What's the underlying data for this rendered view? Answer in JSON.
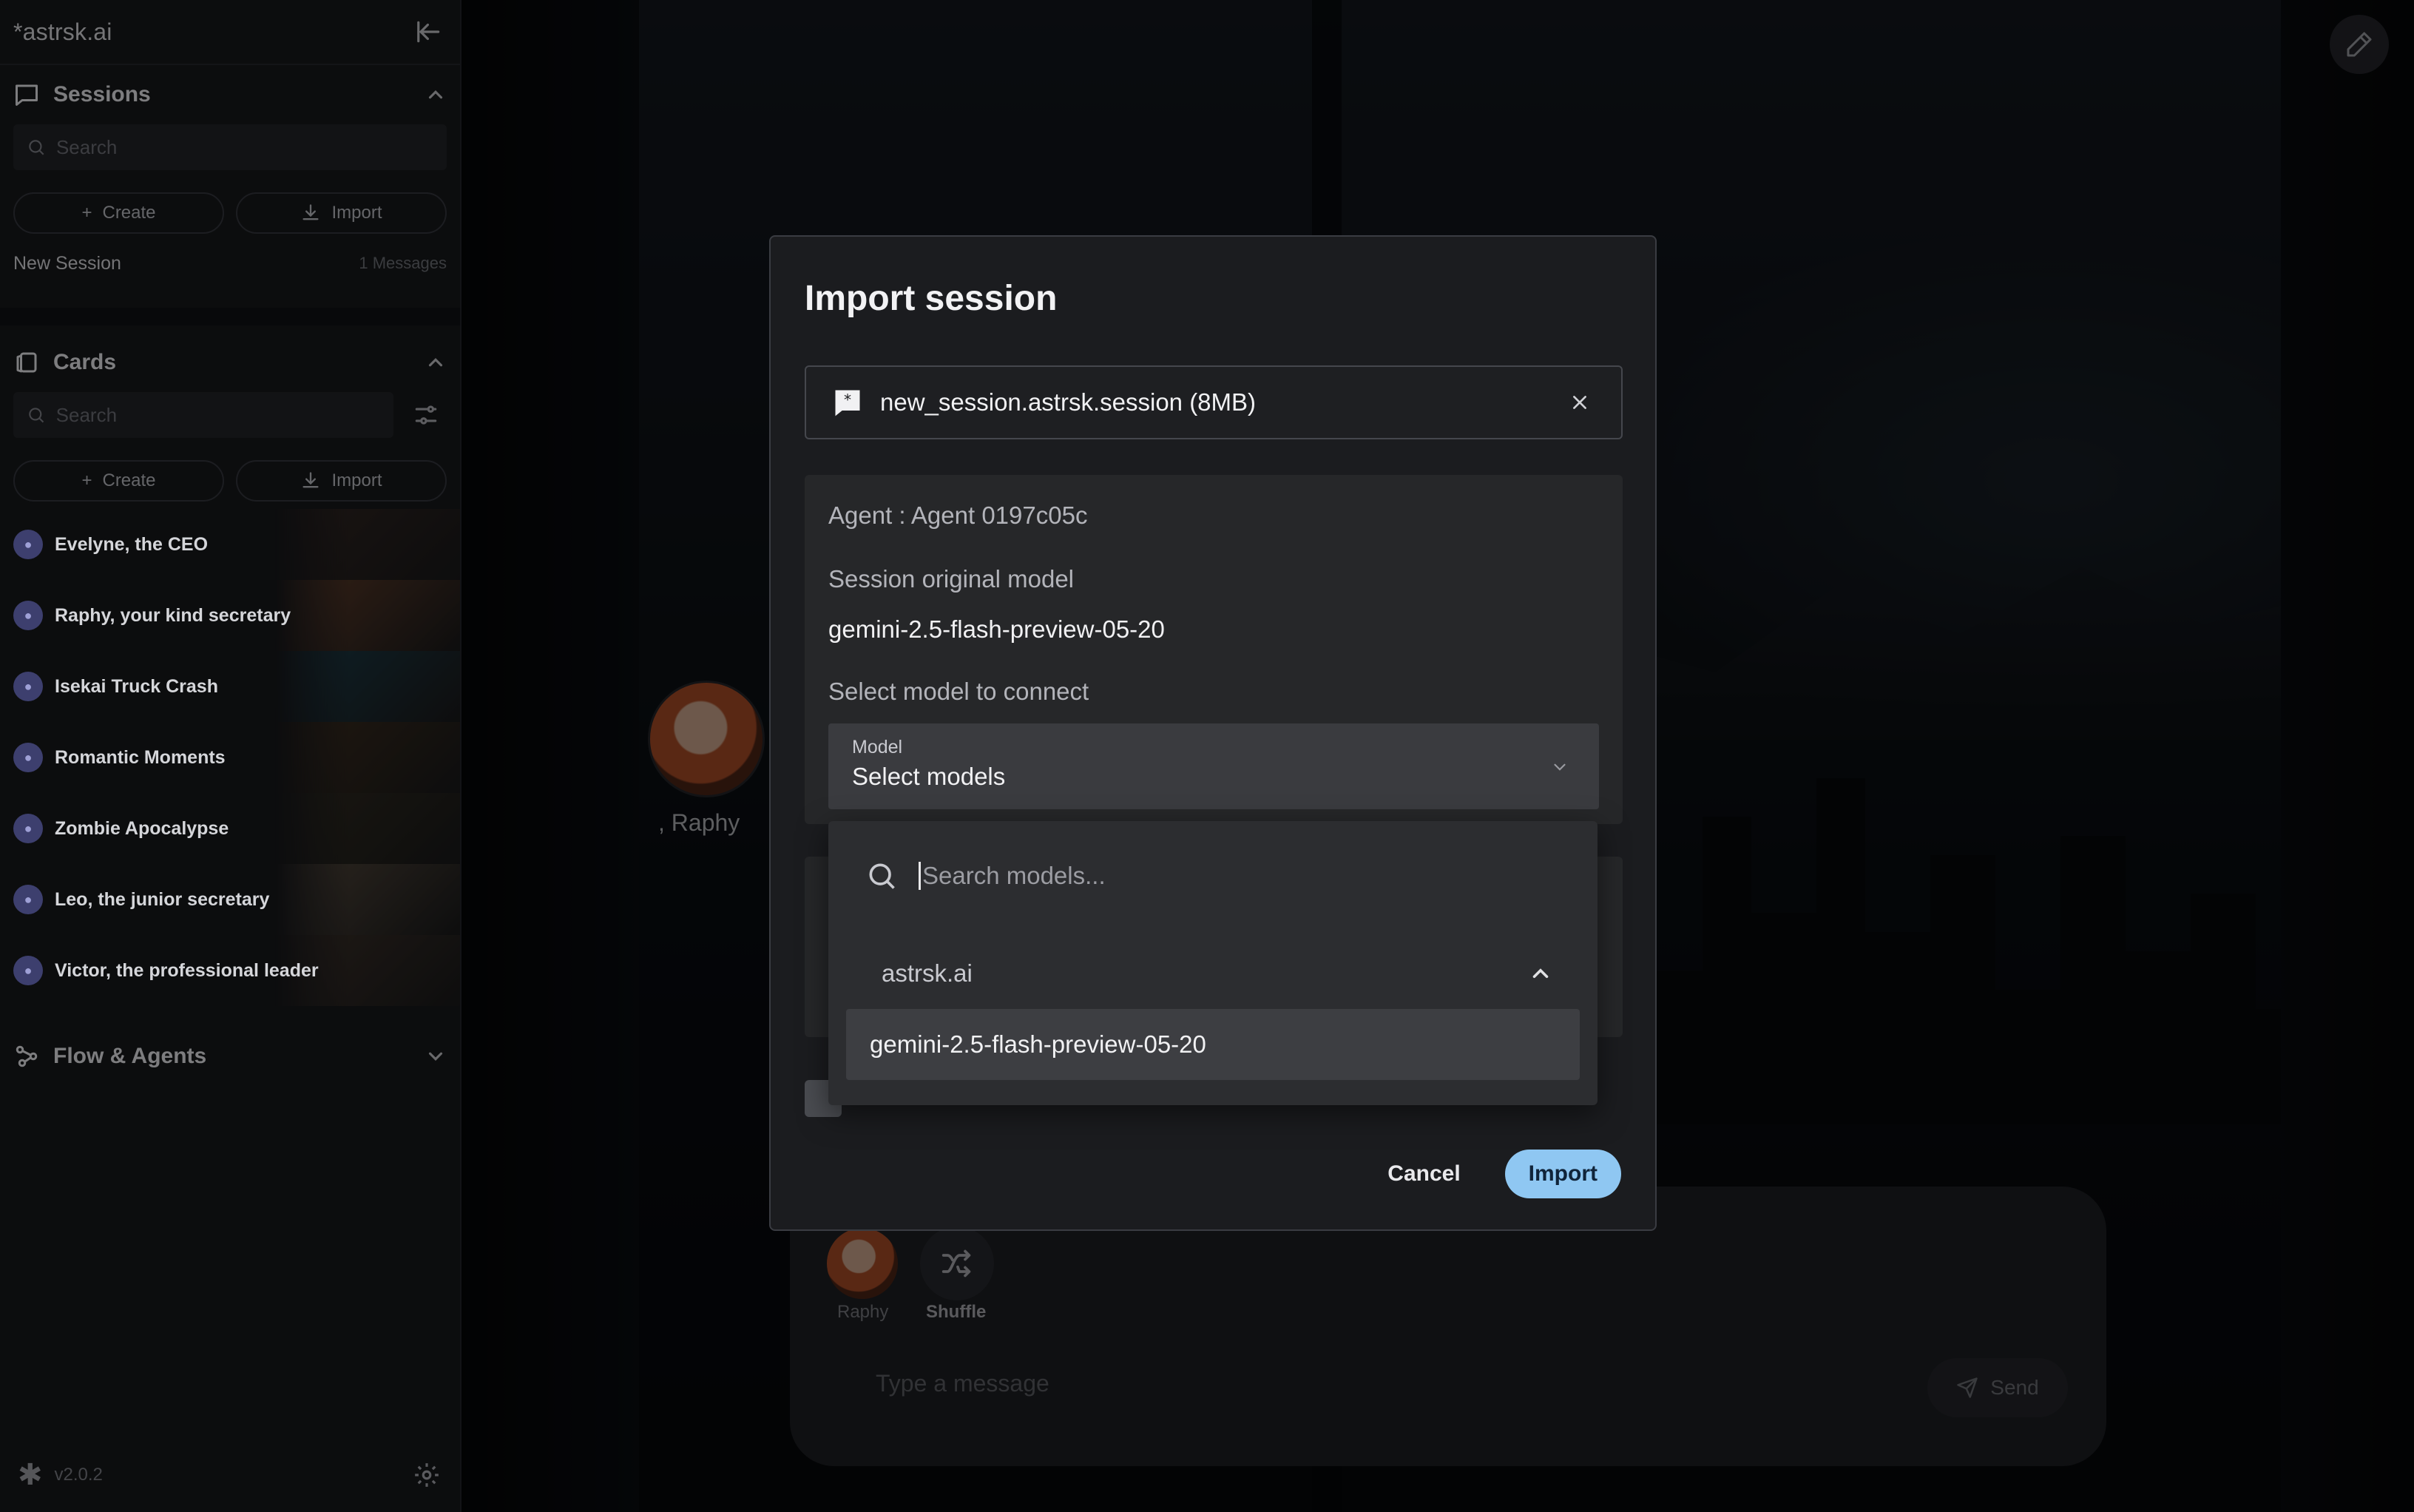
{
  "app": {
    "logo": "*astrsk.ai",
    "version": "v2.0.2"
  },
  "sidebar": {
    "sessions": {
      "title": "Sessions",
      "search_placeholder": "Search",
      "create_label": "Create",
      "import_label": "Import",
      "items": [
        {
          "name": "New Session",
          "count": "1 Messages"
        }
      ]
    },
    "cards": {
      "title": "Cards",
      "search_placeholder": "Search",
      "create_label": "Create",
      "import_label": "Import",
      "items": [
        {
          "name": "Evelyne, the CEO",
          "color": "#3b2a24"
        },
        {
          "name": "Raphy, your kind secretary",
          "color": "#7a4a2e"
        },
        {
          "name": "Isekai Truck Crash",
          "color": "#1f4a5a"
        },
        {
          "name": "Romantic Moments",
          "color": "#4a3520"
        },
        {
          "name": "Zombie Apocalypse",
          "color": "#3a3222"
        },
        {
          "name": "Leo, the junior secretary",
          "color": "#6a5a48"
        },
        {
          "name": "Victor, the professional leader",
          "color": "#4a3a2e"
        }
      ]
    },
    "flow": {
      "title": "Flow & Agents"
    }
  },
  "chat": {
    "character_name": ", Raphy",
    "quick_avatar_label": "Raphy",
    "shuffle_label": "Shuffle",
    "message_placeholder": "Type a message",
    "send_label": "Send"
  },
  "modal": {
    "title": "Import session",
    "file_name": "new_session.astrsk.session (8MB)",
    "agent_label": "Agent : Agent 0197c05c",
    "original_model_label": "Session original model",
    "original_model_value": "gemini-2.5-flash-preview-05-20",
    "select_model_label": "Select model to connect",
    "model_field_label": "Model",
    "model_field_value": "Select models",
    "cancel_label": "Cancel",
    "import_label": "Import"
  },
  "dropdown": {
    "search_placeholder": "Search models...",
    "group_name": "astrsk.ai",
    "options": [
      "gemini-2.5-flash-preview-05-20"
    ]
  },
  "colors": {
    "accent": "#8fc7f2",
    "sidebar_bg": "#17181b",
    "modal_bg": "#1b1c1f"
  }
}
